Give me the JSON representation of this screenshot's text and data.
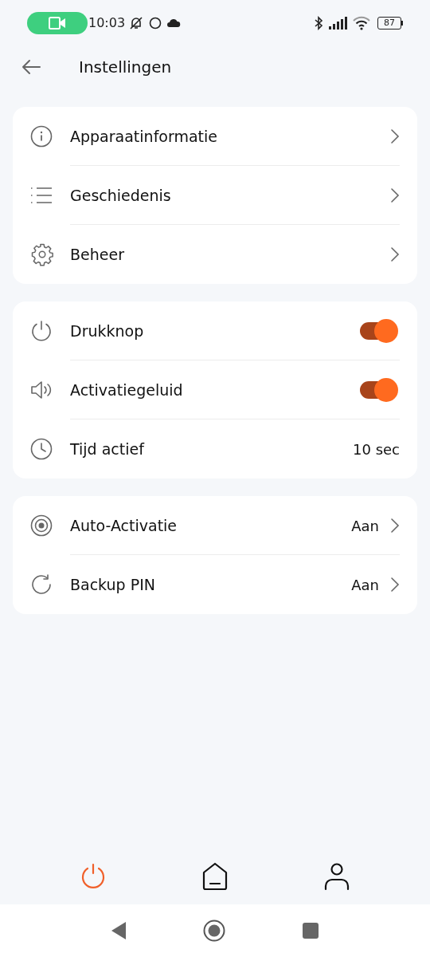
{
  "status_bar": {
    "time": "10:03",
    "battery": "87"
  },
  "header": {
    "title": "Instellingen"
  },
  "cards": [
    {
      "rows": [
        {
          "kind": "link",
          "label": "Apparaatinformatie"
        },
        {
          "kind": "link",
          "label": "Geschiedenis"
        },
        {
          "kind": "link",
          "label": "Beheer"
        }
      ]
    },
    {
      "rows": [
        {
          "kind": "toggle",
          "label": "Drukknop",
          "on": true
        },
        {
          "kind": "toggle",
          "label": "Activatiegeluid",
          "on": true
        },
        {
          "kind": "value",
          "label": "Tijd actief",
          "value": "10 sec"
        }
      ]
    },
    {
      "rows": [
        {
          "kind": "link",
          "label": "Auto-Activatie",
          "value": "Aan"
        },
        {
          "kind": "link",
          "label": "Backup PIN",
          "value": "Aan"
        }
      ]
    }
  ],
  "bottom_nav": [
    {
      "selected": true
    },
    {
      "selected": false
    },
    {
      "selected": false
    }
  ]
}
